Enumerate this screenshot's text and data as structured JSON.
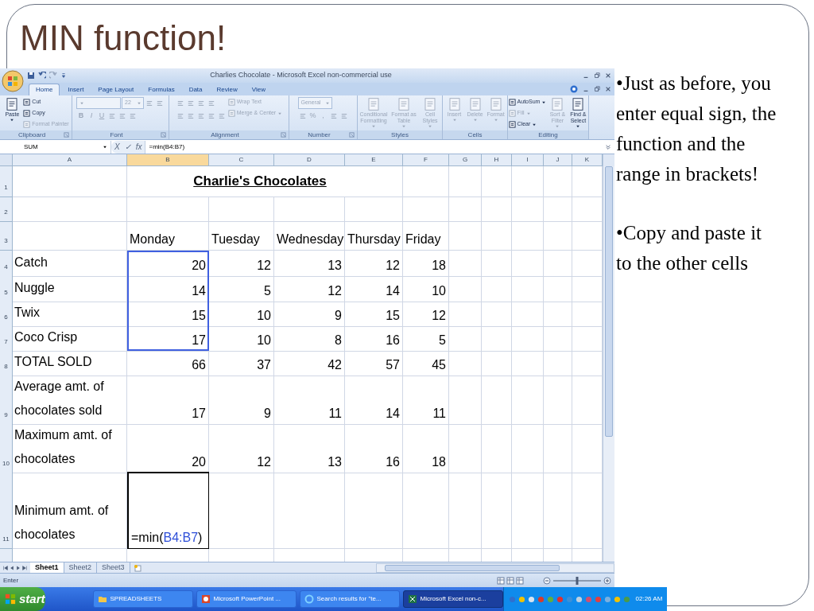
{
  "slide": {
    "title": "MIN function!",
    "bullets": [
      "•Just as before, you enter equal sign, the function  and the range in brackets!",
      "•Copy and paste it to the other cells"
    ]
  },
  "excel": {
    "title": "Charlies Chocolate - Microsoft Excel non-commercial use",
    "tabs": [
      {
        "label": "Home",
        "selected": true
      },
      {
        "label": "Insert",
        "selected": false
      },
      {
        "label": "Page Layout",
        "selected": false
      },
      {
        "label": "Formulas",
        "selected": false
      },
      {
        "label": "Data",
        "selected": false
      },
      {
        "label": "Review",
        "selected": false
      },
      {
        "label": "View",
        "selected": false
      }
    ],
    "ribbon_groups": [
      {
        "label": "Clipboard",
        "launcher": true,
        "sections": [
          {
            "kind": "large",
            "text": "Paste",
            "disabled": false
          },
          {
            "kind": "stack",
            "rows": [
              [
                {
                  "kind": "small",
                  "text": "Cut",
                  "disabled": false,
                  "dropdown": false
                }
              ],
              [
                {
                  "kind": "small",
                  "text": "Copy",
                  "disabled": false,
                  "dropdown": false
                }
              ],
              [
                {
                  "kind": "small",
                  "text": "Format Painter",
                  "disabled": true,
                  "dropdown": false
                }
              ]
            ]
          }
        ]
      },
      {
        "label": "Font",
        "launcher": true,
        "sections": [
          {
            "kind": "stack",
            "rows": [
              [
                {
                  "kind": "combo",
                  "disabled": true
                },
                {
                  "kind": "combo",
                  "text": "22",
                  "disabled": true
                },
                {
                  "kind": "icon",
                  "disabled": true
                },
                {
                  "kind": "icon",
                  "disabled": true
                }
              ],
              [
                {
                  "kind": "bold_glyph",
                  "text": "B",
                  "disabled": true
                },
                {
                  "kind": "italic_glyph",
                  "text": "I",
                  "disabled": true
                },
                {
                  "kind": "underline_glyph",
                  "text": "U",
                  "disabled": true
                },
                {
                  "kind": "icon",
                  "disabled": true
                },
                {
                  "kind": "icon",
                  "disabled": true
                },
                {
                  "kind": "icon",
                  "disabled": true
                }
              ]
            ]
          }
        ]
      },
      {
        "label": "Alignment",
        "launcher": true,
        "sections": [
          {
            "kind": "stack",
            "rows": [
              [
                {
                  "kind": "icon",
                  "disabled": true
                },
                {
                  "kind": "icon",
                  "disabled": true
                },
                {
                  "kind": "icon",
                  "disabled": true
                },
                {
                  "kind": "icon",
                  "disabled": true
                }
              ],
              [
                {
                  "kind": "icon",
                  "disabled": true
                },
                {
                  "kind": "icon",
                  "disabled": true
                },
                {
                  "kind": "icon",
                  "disabled": true
                },
                {
                  "kind": "icon",
                  "disabled": true
                },
                {
                  "kind": "icon",
                  "disabled": true
                }
              ]
            ]
          },
          {
            "kind": "stack",
            "rows": [
              [
                {
                  "kind": "small",
                  "text": "Wrap Text",
                  "disabled": true,
                  "dropdown": false
                }
              ],
              [
                {
                  "kind": "small",
                  "text": "Merge & Center",
                  "disabled": true,
                  "dropdown": true
                }
              ]
            ]
          }
        ]
      },
      {
        "label": "Number",
        "launcher": true,
        "sections": [
          {
            "kind": "stack",
            "rows": [
              [
                {
                  "kind": "combo",
                  "text": "General",
                  "disabled": true
                }
              ],
              [
                {
                  "kind": "icon",
                  "disabled": true
                },
                {
                  "kind": "glyph",
                  "text": "%",
                  "disabled": true
                },
                {
                  "kind": "glyph",
                  "text": ",",
                  "disabled": true
                },
                {
                  "kind": "icon",
                  "disabled": true
                },
                {
                  "kind": "icon",
                  "disabled": true
                }
              ]
            ]
          }
        ]
      },
      {
        "label": "Styles",
        "launcher": false,
        "sections": [
          {
            "kind": "large",
            "text": "Conditional Formatting",
            "disabled": true
          },
          {
            "kind": "large",
            "text": "Format as Table",
            "disabled": true
          },
          {
            "kind": "large",
            "text": "Cell Styles",
            "disabled": true
          }
        ]
      },
      {
        "label": "Cells",
        "launcher": false,
        "sections": [
          {
            "kind": "large",
            "text": "Insert",
            "disabled": true
          },
          {
            "kind": "large",
            "text": "Delete",
            "disabled": true
          },
          {
            "kind": "large",
            "text": "Format",
            "disabled": true
          }
        ]
      },
      {
        "label": "Editing",
        "launcher": false,
        "sections": [
          {
            "kind": "stack",
            "rows": [
              [
                {
                  "kind": "small",
                  "text": "AutoSum",
                  "disabled": false,
                  "dropdown": true
                }
              ],
              [
                {
                  "kind": "small",
                  "text": "Fill",
                  "disabled": true,
                  "dropdown": true
                }
              ],
              [
                {
                  "kind": "small",
                  "text": "Clear",
                  "disabled": false,
                  "dropdown": true
                }
              ]
            ]
          },
          {
            "kind": "large",
            "text": "Sort & Filter",
            "disabled": true
          },
          {
            "kind": "large",
            "text": "Find & Select",
            "disabled": false
          }
        ]
      }
    ],
    "formula_bar": {
      "name_box": "SUM",
      "buttons": [
        "X",
        "✓",
        "fx"
      ],
      "formula": "=min(B4:B7)"
    },
    "columns": [
      {
        "label": "A",
        "selected": false
      },
      {
        "label": "B",
        "selected": true
      },
      {
        "label": "C",
        "selected": false
      },
      {
        "label": "D",
        "selected": false
      },
      {
        "label": "E",
        "selected": false
      },
      {
        "label": "F",
        "selected": false
      },
      {
        "label": "G",
        "selected": false
      },
      {
        "label": "H",
        "selected": false
      },
      {
        "label": "I",
        "selected": false
      },
      {
        "label": "J",
        "selected": false
      },
      {
        "label": "K",
        "selected": false
      }
    ],
    "rows": [
      {
        "number": "1",
        "kind": "title",
        "title": "Charlie's Chocolates",
        "in_range": false
      },
      {
        "number": "2",
        "kind": "blank",
        "in_range": false
      },
      {
        "number": "3",
        "kind": "header",
        "values": [
          "Monday",
          "Tuesday",
          "Wednesday",
          "Thursday",
          "Friday"
        ],
        "in_range": false
      },
      {
        "number": "4",
        "kind": "data",
        "label": "Catch",
        "values": [
          "20",
          "12",
          "13",
          "12",
          "18"
        ],
        "in_range": true
      },
      {
        "number": "5",
        "kind": "data",
        "label": "Nuggle",
        "values": [
          "14",
          "5",
          "12",
          "14",
          "10"
        ],
        "in_range": true
      },
      {
        "number": "6",
        "kind": "data",
        "label": "Twix",
        "values": [
          "15",
          "10",
          "9",
          "15",
          "12"
        ],
        "in_range": true
      },
      {
        "number": "7",
        "kind": "data",
        "label": "Coco Crisp",
        "values": [
          "17",
          "10",
          "8",
          "16",
          "5"
        ],
        "in_range": true
      },
      {
        "number": "8",
        "kind": "data",
        "label": "TOTAL SOLD",
        "values": [
          "66",
          "37",
          "42",
          "57",
          "45"
        ],
        "in_range": false
      },
      {
        "number": "9",
        "kind": "data",
        "label": "Average amt. of chocolates sold",
        "values": [
          "17",
          "9",
          "11",
          "14",
          "11"
        ],
        "in_range": false
      },
      {
        "number": "10",
        "kind": "data",
        "label": "Maximum amt. of chocolates",
        "values": [
          "20",
          "12",
          "13",
          "16",
          "18"
        ],
        "in_range": false
      },
      {
        "number": "11",
        "kind": "data",
        "label": "Minimum amt. of chocolates",
        "values": [
          {
            "active": true,
            "parts": [
              {
                "text": "=min(",
                "kind": "plain"
              },
              {
                "text": "B4:B7",
                "kind": "reference"
              },
              {
                "text": ")",
                "kind": "plain"
              }
            ]
          }
        ],
        "in_range": false
      }
    ],
    "sheet_tabs": [
      {
        "label": "Sheet1",
        "selected": true
      },
      {
        "label": "Sheet2",
        "selected": false
      },
      {
        "label": "Sheet3",
        "selected": false
      }
    ],
    "status": "Enter",
    "zoom": {
      "level": 0.5
    },
    "taskbar": {
      "start": "start",
      "items": [
        {
          "kind": "folder",
          "label": "SPREADSHEETS",
          "selected": false
        },
        {
          "kind": "powerpoint",
          "label": "Microsoft PowerPoint ...",
          "selected": false
        },
        {
          "kind": "browser",
          "label": "Search results for \"te...",
          "selected": false
        },
        {
          "kind": "excel",
          "label": "Microsoft Excel non-c...",
          "selected": true
        }
      ],
      "clock": "02:26 AM"
    }
  }
}
